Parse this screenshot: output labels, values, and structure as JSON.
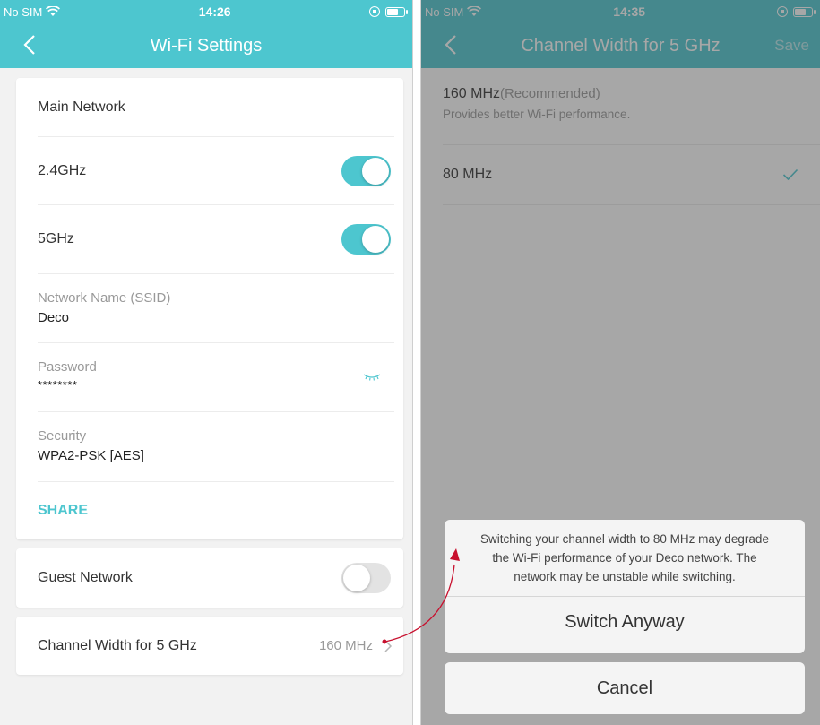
{
  "left_screen": {
    "status": {
      "carrier": "No SIM",
      "time": "14:26"
    },
    "nav": {
      "title": "Wi-Fi Settings"
    },
    "main_network": {
      "header": "Main Network",
      "band_24": {
        "label": "2.4GHz",
        "enabled": true
      },
      "band_5": {
        "label": "5GHz",
        "enabled": true
      },
      "ssid": {
        "label": "Network Name (SSID)",
        "value": "Deco"
      },
      "password": {
        "label": "Password",
        "value": "********"
      },
      "security": {
        "label": "Security",
        "value": "WPA2-PSK [AES]"
      },
      "share_label": "SHARE"
    },
    "guest_network": {
      "label": "Guest Network",
      "enabled": false
    },
    "channel_width": {
      "label": "Channel Width for 5 GHz",
      "value": "160 MHz"
    }
  },
  "right_screen": {
    "status": {
      "carrier": "No SIM",
      "time": "14:35"
    },
    "nav": {
      "title": "Channel Width for 5 GHz",
      "save_label": "Save"
    },
    "options": [
      {
        "label": "160 MHz",
        "tag": "(Recommended)",
        "desc": "Provides better Wi-Fi performance.",
        "selected": false
      },
      {
        "label": "80 MHz",
        "selected": true
      }
    ],
    "dialog": {
      "message_1": "Switching your channel width to 80 MHz may degrade",
      "message_2": "the Wi-Fi performance of your Deco network. The",
      "message_3": "network may be unstable while switching.",
      "confirm_label": "Switch Anyway",
      "cancel_label": "Cancel"
    }
  },
  "colors": {
    "accent": "#4dc6cf",
    "annotation": "#c8102e"
  },
  "icons": [
    "wifi-icon",
    "battery-icon",
    "orientation-lock-icon",
    "back-chevron-icon",
    "eye-closed-icon",
    "chevron-right-icon",
    "checkmark-icon"
  ]
}
